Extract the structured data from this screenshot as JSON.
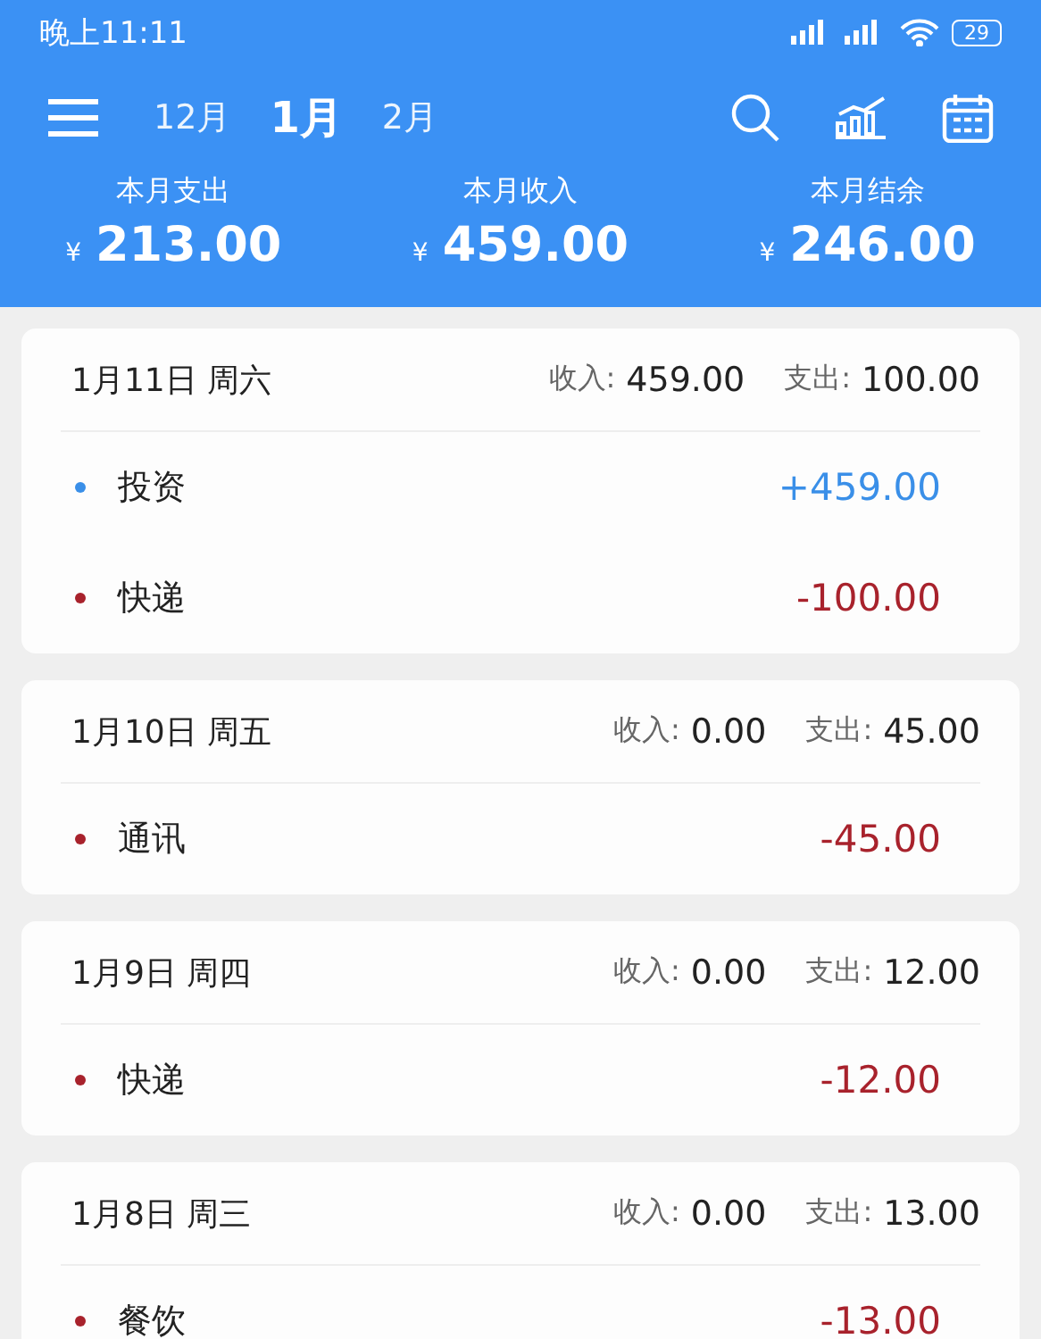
{
  "status_bar": {
    "time": "晚上11:11",
    "battery": "29"
  },
  "toolbar": {
    "months": [
      {
        "label": "12月",
        "selected": false
      },
      {
        "label": "1月",
        "selected": true
      },
      {
        "label": "2月",
        "selected": false
      }
    ]
  },
  "summary": [
    {
      "label": "本月支出",
      "currency": "¥",
      "amount": "213.00"
    },
    {
      "label": "本月收入",
      "currency": "¥",
      "amount": "459.00"
    },
    {
      "label": "本月结余",
      "currency": "¥",
      "amount": "246.00"
    }
  ],
  "days": [
    {
      "date": "1月11日 周六",
      "income_label": "收入:",
      "income": "459.00",
      "expense_label": "支出:",
      "expense": "100.00",
      "items": [
        {
          "category": "投资",
          "amount": "+459.00",
          "kind": "income"
        },
        {
          "category": "快递",
          "amount": "-100.00",
          "kind": "expense"
        }
      ]
    },
    {
      "date": "1月10日 周五",
      "income_label": "收入:",
      "income": "0.00",
      "expense_label": "支出:",
      "expense": "45.00",
      "items": [
        {
          "category": "通讯",
          "amount": "-45.00",
          "kind": "expense"
        }
      ]
    },
    {
      "date": "1月9日 周四",
      "income_label": "收入:",
      "income": "0.00",
      "expense_label": "支出:",
      "expense": "12.00",
      "items": [
        {
          "category": "快递",
          "amount": "-12.00",
          "kind": "expense"
        }
      ]
    },
    {
      "date": "1月8日 周三",
      "income_label": "收入:",
      "income": "0.00",
      "expense_label": "支出:",
      "expense": "13.00",
      "items": [
        {
          "category": "餐饮",
          "amount": "-13.00",
          "kind": "expense"
        }
      ]
    }
  ]
}
